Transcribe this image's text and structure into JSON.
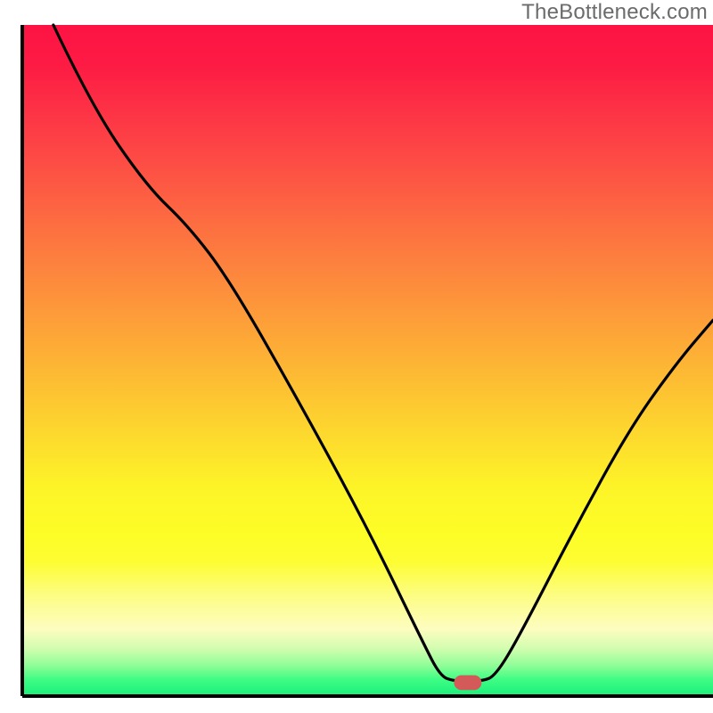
{
  "watermark": "TheBottleneck.com",
  "chart_data": {
    "type": "line",
    "title": "",
    "xlabel": "",
    "ylabel": "",
    "xlim": [
      0,
      100
    ],
    "ylim": [
      0,
      100
    ],
    "background_gradient_stops": [
      {
        "offset": 0.0,
        "color": "#fd1343"
      },
      {
        "offset": 0.06,
        "color": "#fd1b44"
      },
      {
        "offset": 0.13,
        "color": "#fd3345"
      },
      {
        "offset": 0.2,
        "color": "#fd4b45"
      },
      {
        "offset": 0.27,
        "color": "#fd6442"
      },
      {
        "offset": 0.34,
        "color": "#fd7c3f"
      },
      {
        "offset": 0.41,
        "color": "#fd943b"
      },
      {
        "offset": 0.48,
        "color": "#fdac36"
      },
      {
        "offset": 0.55,
        "color": "#fdc432"
      },
      {
        "offset": 0.62,
        "color": "#fddc2d"
      },
      {
        "offset": 0.69,
        "color": "#fdf428"
      },
      {
        "offset": 0.76,
        "color": "#fdfd27"
      },
      {
        "offset": 0.8,
        "color": "#fdfd33"
      },
      {
        "offset": 0.85,
        "color": "#fdfd84"
      },
      {
        "offset": 0.9,
        "color": "#fdfdc0"
      },
      {
        "offset": 0.93,
        "color": "#d0fdaf"
      },
      {
        "offset": 0.955,
        "color": "#8efd97"
      },
      {
        "offset": 0.975,
        "color": "#3ffd84"
      },
      {
        "offset": 1.0,
        "color": "#18f07b"
      }
    ],
    "series": [
      {
        "name": "bottleneck-curve",
        "points": [
          {
            "x": 4.5,
            "y": 100.0
          },
          {
            "x": 10.0,
            "y": 88.0
          },
          {
            "x": 18.0,
            "y": 76.0
          },
          {
            "x": 24.0,
            "y": 70.1
          },
          {
            "x": 30.0,
            "y": 62.0
          },
          {
            "x": 40.0,
            "y": 44.0
          },
          {
            "x": 50.0,
            "y": 25.0
          },
          {
            "x": 58.0,
            "y": 8.0
          },
          {
            "x": 60.5,
            "y": 3.0
          },
          {
            "x": 62.5,
            "y": 2.2
          },
          {
            "x": 66.5,
            "y": 2.2
          },
          {
            "x": 68.5,
            "y": 3.0
          },
          {
            "x": 72.0,
            "y": 9.0
          },
          {
            "x": 80.0,
            "y": 25.0
          },
          {
            "x": 88.0,
            "y": 40.0
          },
          {
            "x": 95.0,
            "y": 50.0
          },
          {
            "x": 100.0,
            "y": 56.0
          }
        ]
      }
    ],
    "marker": {
      "name": "optimal-marker",
      "x": 64.5,
      "y": 2.0,
      "color": "#d45a5a",
      "width": 4.0,
      "height": 2.2
    },
    "axes": {
      "left": true,
      "bottom": true,
      "rightEdge": 100,
      "topEdge": 100
    }
  }
}
